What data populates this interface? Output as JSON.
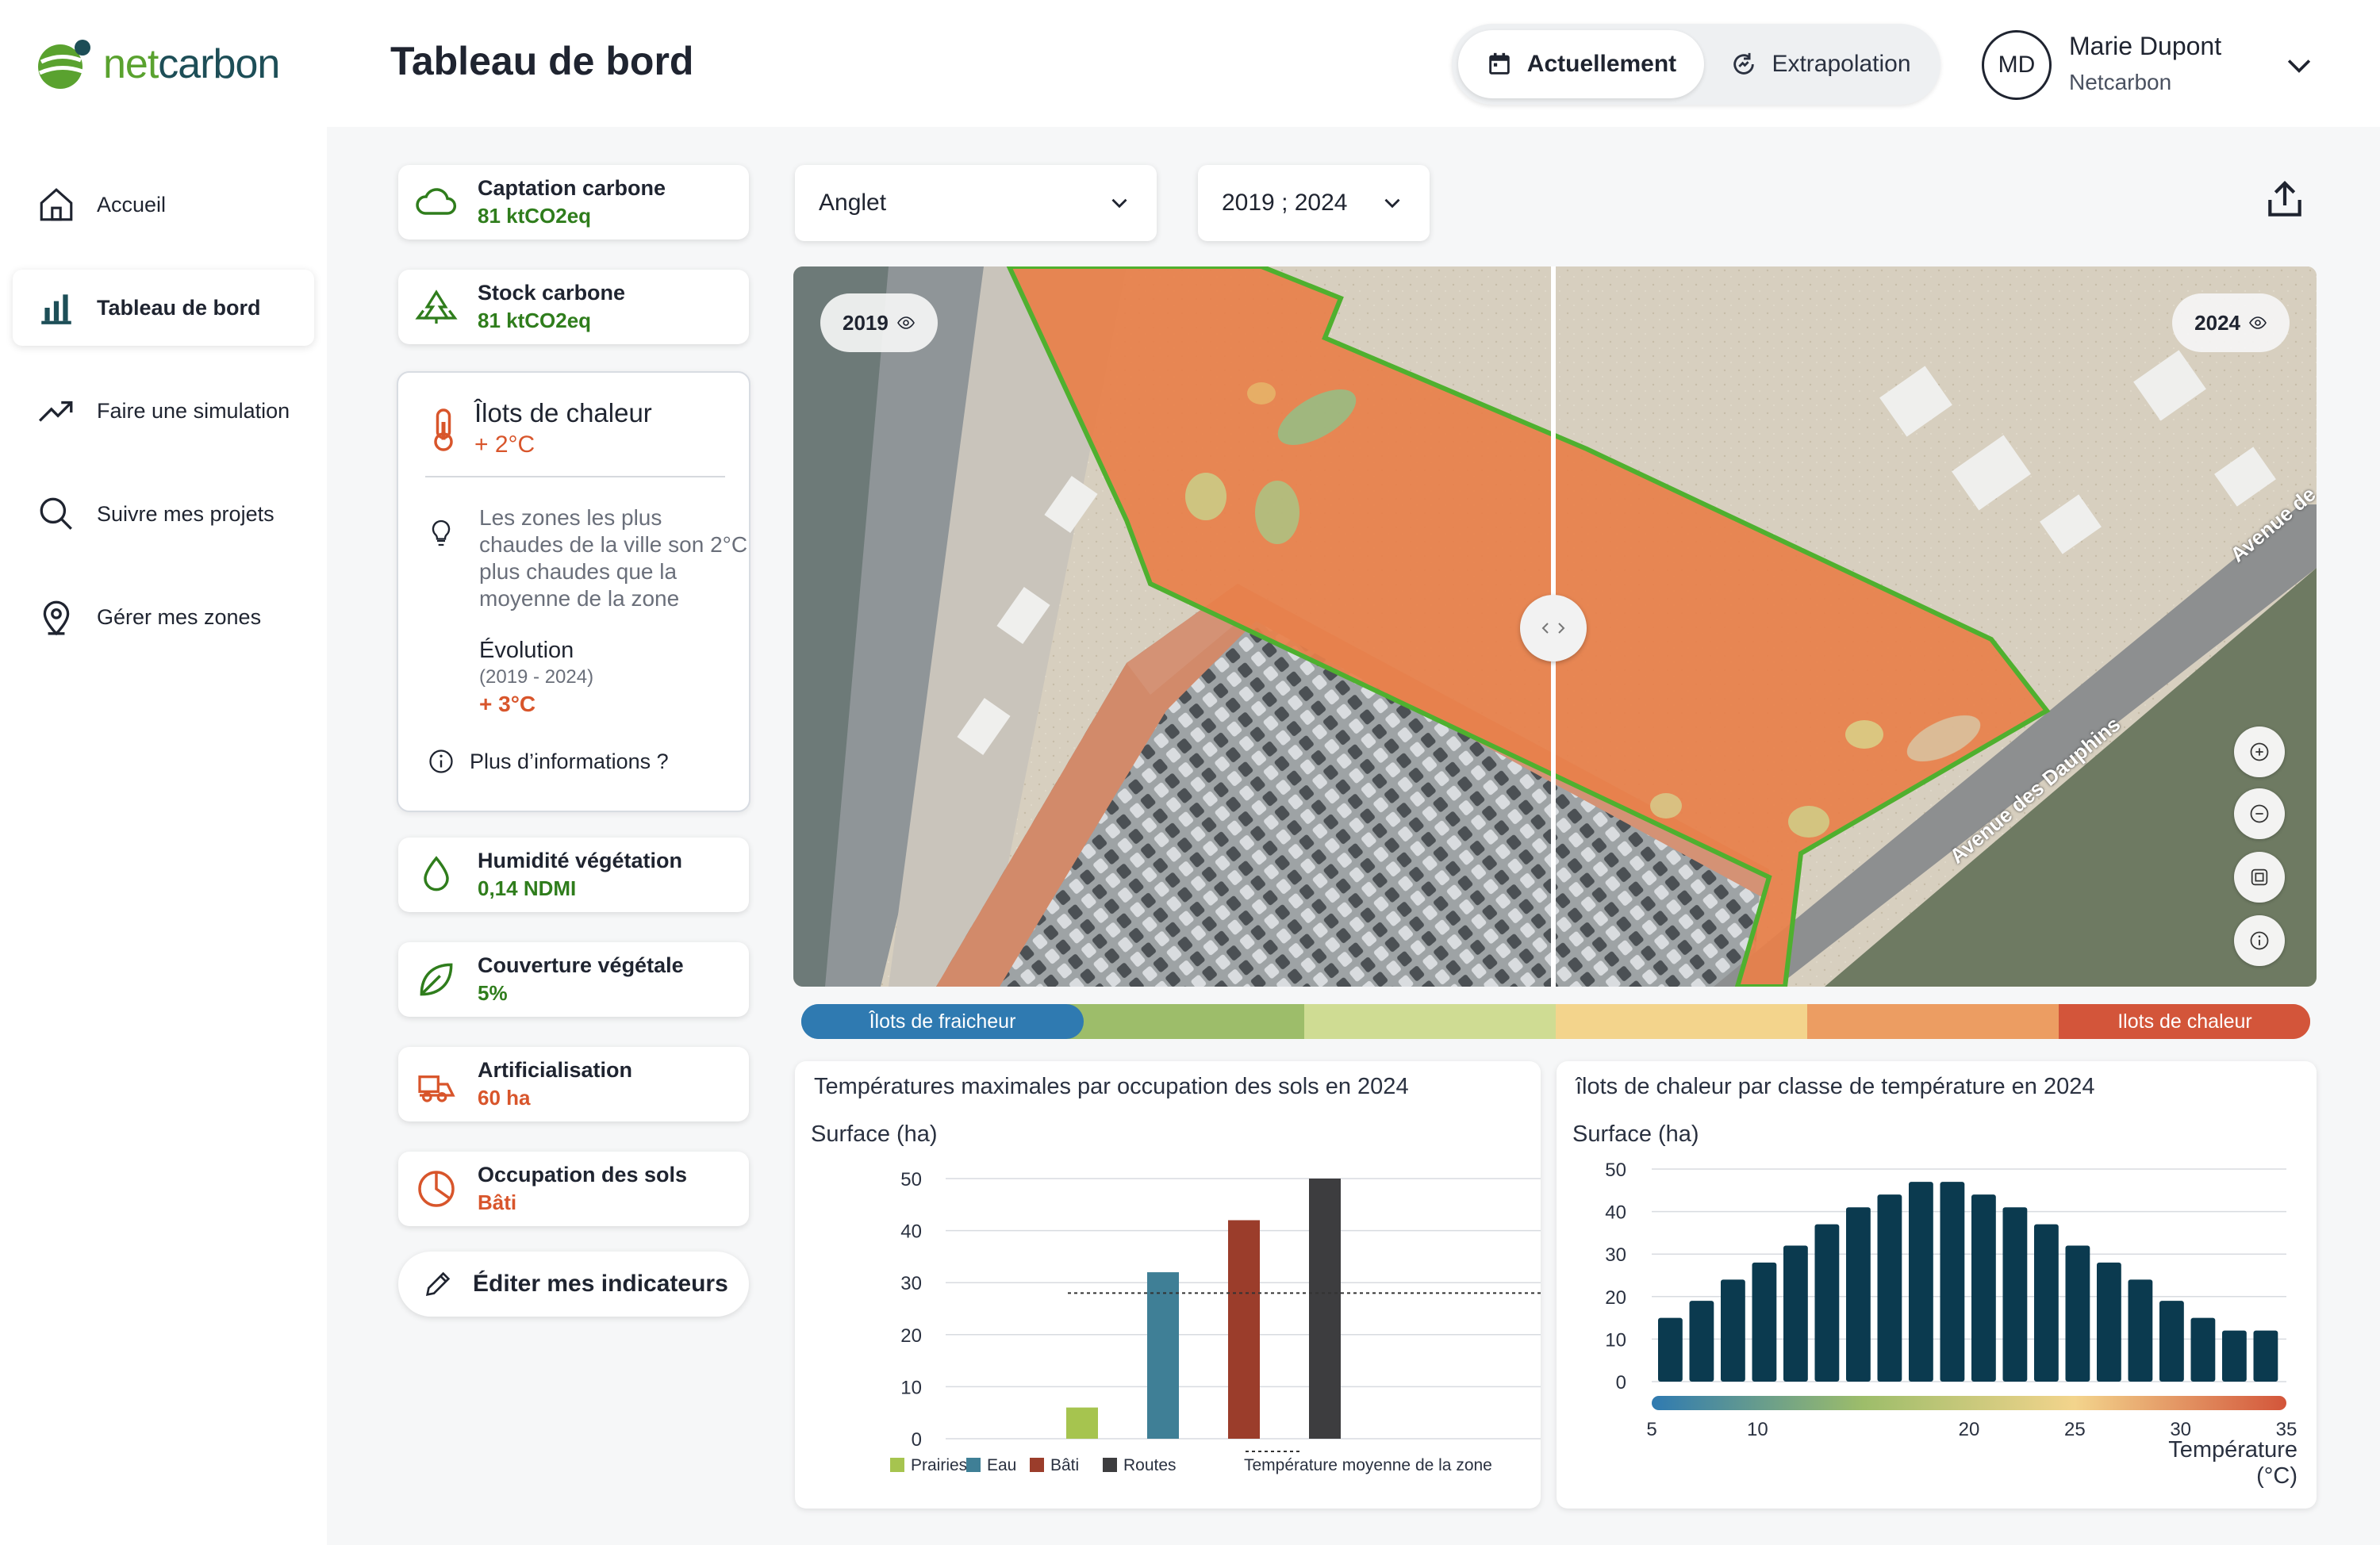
{
  "app": {
    "logo_text_a": "net",
    "logo_text_b": "carbon"
  },
  "header": {
    "title": "Tableau de bord",
    "mode_now": "Actuellement",
    "mode_extrapolation": "Extrapolation",
    "user_initials": "MD",
    "user_name": "Marie Dupont",
    "user_org": "Netcarbon"
  },
  "sidebar": {
    "items": [
      {
        "label": "Accueil",
        "icon": "home-icon"
      },
      {
        "label": "Tableau de bord",
        "icon": "bar-chart-icon",
        "active": true
      },
      {
        "label": "Faire une simulation",
        "icon": "trend-icon"
      },
      {
        "label": "Suivre mes projets",
        "icon": "search-icon"
      },
      {
        "label": "Gérer mes zones",
        "icon": "location-pin-icon"
      }
    ]
  },
  "indicators": {
    "captation": {
      "title": "Captation carbone",
      "value": "81 ktCO2eq"
    },
    "stock": {
      "title": "Stock carbone",
      "value": "81 ktCO2eq"
    },
    "heat": {
      "title": "Îlots de chaleur",
      "value": "+ 2°C",
      "description": "Les zones les plus chaudes de la ville son 2°C plus chaudes que la moyenne de la zone",
      "evolution_label": "Évolution",
      "evolution_years": "(2019 - 2024)",
      "evolution_value": "+ 3°C",
      "more_info": "Plus d’informations ?"
    },
    "humidity": {
      "title": "Humidité végétation",
      "value": "0,14 NDMI"
    },
    "vegetation": {
      "title": "Couverture végétale",
      "value": "5%"
    },
    "artificialisation": {
      "title": "Artificialisation",
      "value": "60 ha"
    },
    "land_use": {
      "title": "Occupation des sols",
      "value": "Bâti"
    },
    "edit_label": "Éditer mes indicateurs"
  },
  "filters": {
    "city": "Anglet",
    "years": "2019 ; 2024"
  },
  "map": {
    "badge_left": "2019",
    "badge_right": "2024",
    "street_1": "Avenue des Dauphins",
    "street_2": "Avenue de",
    "legend_cool": "Îlots de fraicheur",
    "legend_hot": "Ilots de chaleur",
    "legend_colors": [
      "#2f7ab1",
      "#9dbd6a",
      "#cfdc93",
      "#f3d48c",
      "#ec9d62",
      "#d3553a"
    ]
  },
  "charts": {
    "chart1_title": "Températures maximales par occupation des sols en 2024",
    "chart1_unit": "Surface (ha)",
    "chart2_title": "îlots de chaleur par classe de température en 2024",
    "chart2_unit": "Surface (ha)",
    "chart2_xlabel_1": "Température",
    "chart2_xlabel_2": "(°C)"
  },
  "chart_data": [
    {
      "type": "bar",
      "title": "Températures maximales par occupation des sols en 2024",
      "ylabel": "Surface (ha)",
      "categories": [
        "Prairies",
        "Eau",
        "Bâti",
        "Routes"
      ],
      "values": [
        6,
        32,
        42,
        50
      ],
      "colors": [
        "#a6c44f",
        "#3f7f96",
        "#9b3d2b",
        "#3d3d3f"
      ],
      "ylim": [
        0,
        50
      ],
      "yticks": [
        0,
        10,
        20,
        30,
        40,
        50
      ],
      "reference_line": {
        "label": "Température moyenne de la zone",
        "value": 28
      },
      "grid": true,
      "legend": "bottom"
    },
    {
      "type": "bar",
      "title": "îlots de chaleur par classe de température en 2024",
      "ylabel": "Surface (ha)",
      "xlabel": "Température (°C)",
      "x": [
        5,
        6.5,
        8,
        9.5,
        11,
        12.5,
        14,
        15.5,
        17,
        18.5,
        20,
        21.5,
        23,
        24.5,
        26,
        27.5,
        29,
        30.5,
        32,
        33.5
      ],
      "values": [
        15,
        19,
        24,
        28,
        32,
        37,
        41,
        44,
        47,
        47,
        44,
        41,
        37,
        32,
        28,
        24,
        19,
        15,
        12,
        12
      ],
      "bar_color": "#0b3a4f",
      "ylim": [
        0,
        50
      ],
      "yticks": [
        0,
        10,
        20,
        30,
        40,
        50
      ],
      "xticks": [
        5,
        10,
        20,
        25,
        30,
        35
      ],
      "colorbar": [
        "#2f7ab1",
        "#9dbd6a",
        "#f3d48c",
        "#d3553a"
      ],
      "grid": true
    }
  ]
}
